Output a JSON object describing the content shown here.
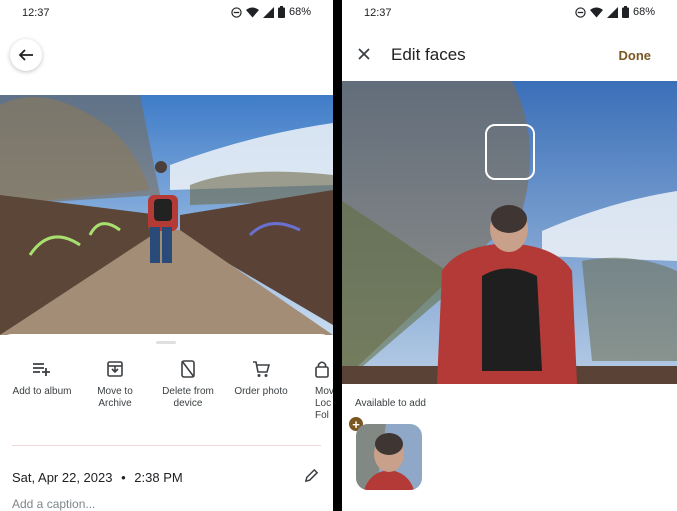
{
  "left": {
    "status": {
      "time": "12:37",
      "battery": "68%"
    },
    "actions": [
      {
        "label": "Add to album",
        "icon": "playlist-add-icon"
      },
      {
        "label": "Move to Archive",
        "icon": "archive-icon"
      },
      {
        "label": "Delete from device",
        "icon": "delete-device-icon"
      },
      {
        "label": "Order photo",
        "icon": "cart-icon"
      },
      {
        "label": "Mov Loc Fol",
        "icon": "lock-folder-icon"
      }
    ],
    "date": "Sat, Apr 22, 2023",
    "separator": "•",
    "time": "2:38 PM",
    "caption_placeholder": "Add a caption..."
  },
  "right": {
    "status": {
      "time": "12:37",
      "battery": "68%"
    },
    "title": "Edit faces",
    "done_label": "Done",
    "available_label": "Available to add",
    "plus_glyph": "+"
  },
  "colors": {
    "accent": "#7a5620",
    "divider": "#f3d7d7"
  }
}
